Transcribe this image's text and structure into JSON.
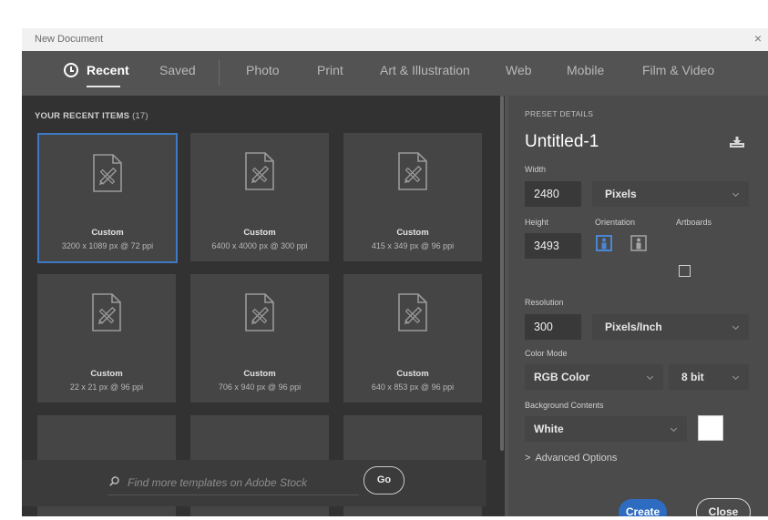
{
  "window": {
    "title": "New Document",
    "close_glyph": "×"
  },
  "tabs": [
    {
      "label": "Recent",
      "active": true,
      "icon": "clock-icon"
    },
    {
      "label": "Saved"
    },
    {
      "label": "Photo"
    },
    {
      "label": "Print"
    },
    {
      "label": "Art & Illustration"
    },
    {
      "label": "Web"
    },
    {
      "label": "Mobile"
    },
    {
      "label": "Film & Video"
    }
  ],
  "recent": {
    "heading": "YOUR RECENT ITEMS",
    "count": "(17)",
    "items": [
      {
        "name": "Custom",
        "dims": "3200 x 1089 px @ 72 ppi",
        "selected": true
      },
      {
        "name": "Custom",
        "dims": "6400 x 4000 px @ 300 ppi"
      },
      {
        "name": "Custom",
        "dims": "415 x 349 px @ 96 ppi"
      },
      {
        "name": "Custom",
        "dims": "22 x 21 px @ 96 ppi"
      },
      {
        "name": "Custom",
        "dims": "706 x 940 px @ 96 ppi"
      },
      {
        "name": "Custom",
        "dims": "640 x 853 px @ 96 ppi"
      },
      {
        "name": "",
        "dims": ""
      },
      {
        "name": "",
        "dims": ""
      },
      {
        "name": "",
        "dims": ""
      }
    ],
    "item_icon": "document-pencil-icon"
  },
  "search": {
    "placeholder": "Find more templates on Adobe Stock",
    "go_label": "Go"
  },
  "preset": {
    "heading": "PRESET DETAILS",
    "name": "Untitled-1",
    "width_label": "Width",
    "width": "2480",
    "width_unit": "Pixels",
    "height_label": "Height",
    "height": "3493",
    "orientation_label": "Orientation",
    "artboards_label": "Artboards",
    "orientation_selected": "portrait",
    "artboards_checked": false,
    "resolution_label": "Resolution",
    "resolution": "300",
    "resolution_unit": "Pixels/Inch",
    "color_mode_label": "Color Mode",
    "color_mode": "RGB Color",
    "bit_depth": "8 bit",
    "background_label": "Background Contents",
    "background": "White",
    "background_swatch": "#ffffff",
    "advanced_label": "Advanced Options",
    "create_label": "Create",
    "close_label": "Close"
  },
  "colors": {
    "accent": "#2d6cc0",
    "selection": "#3f79c4",
    "panel_dark": "#323232",
    "panel_right": "#4b4b4b"
  }
}
